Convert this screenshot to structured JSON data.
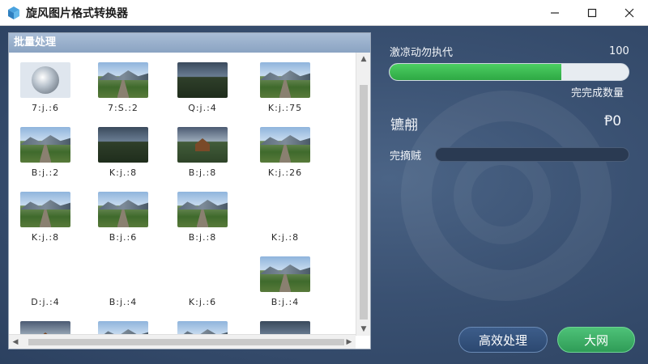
{
  "window": {
    "title": "旋风图片格式转换器",
    "app_icon": "cube-icon",
    "controls": [
      "minimize-icon",
      "maximize-icon",
      "close-icon"
    ]
  },
  "left_panel": {
    "header": "批量处理",
    "thumbnails": [
      {
        "caption": "7:j.:6",
        "style": "logo"
      },
      {
        "caption": "7:S.:2",
        "style": "landscape"
      },
      {
        "caption": "Q:j.:4",
        "style": "dark"
      },
      {
        "caption": "K:j.:75",
        "style": "landscape"
      },
      {
        "caption": "B:j.:2",
        "style": "landscape"
      },
      {
        "caption": "K:j.:8",
        "style": "dark"
      },
      {
        "caption": "B:j.:8",
        "style": "house"
      },
      {
        "caption": "K:j.:26",
        "style": "landscape"
      },
      {
        "caption": "K:j.:8",
        "style": "landscape"
      },
      {
        "caption": "B:j.:6",
        "style": "landscape"
      },
      {
        "caption": "B:j.:8",
        "style": "landscape"
      },
      {
        "caption": "K:j.:8",
        "style": "tilt"
      },
      {
        "caption": "D:j.:4",
        "style": "tilt"
      },
      {
        "caption": "B:j.:4",
        "style": "tilt"
      },
      {
        "caption": "K:j.:6",
        "style": "tilt"
      },
      {
        "caption": "B:j.:4",
        "style": "landscape"
      },
      {
        "caption": "",
        "style": "house"
      },
      {
        "caption": "",
        "style": "landscape"
      },
      {
        "caption": "",
        "style": "landscape"
      },
      {
        "caption": "",
        "style": "dark"
      }
    ]
  },
  "right_panel": {
    "progress_label": "激凉动勿执代",
    "progress_value": "100",
    "progress_fraction": 0.72,
    "completed_label": "完完成数量",
    "result_label": "镳䎃",
    "result_value": "Ᵽ0",
    "second_label": "完摘贼",
    "second_fraction": 0.0
  },
  "buttons": {
    "process": "高效处理",
    "web": "大网"
  },
  "colors": {
    "accent_green": "#2ea844",
    "panel_bg": "#3a5172",
    "header_blue": "#8aa3c2"
  }
}
